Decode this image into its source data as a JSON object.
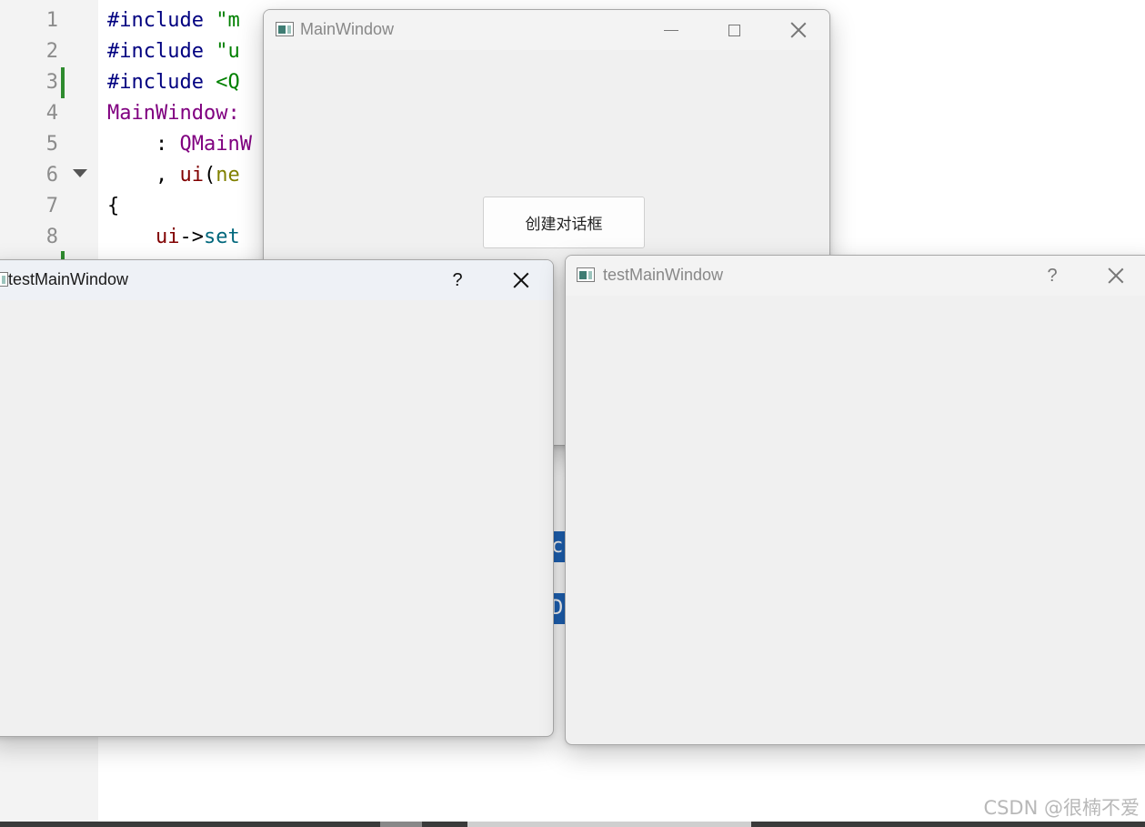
{
  "editor": {
    "line_numbers": [
      "1",
      "2",
      "3",
      "4",
      "5",
      "6",
      "7",
      "8"
    ],
    "lines": [
      [
        {
          "t": "#include ",
          "c": "dir"
        },
        {
          "t": "\"m",
          "c": "str"
        }
      ],
      [
        {
          "t": "#include ",
          "c": "dir"
        },
        {
          "t": "\"u",
          "c": "str"
        }
      ],
      [
        {
          "t": "#include ",
          "c": "dir"
        },
        {
          "t": "<Q",
          "c": "str"
        }
      ],
      [
        {
          "t": "MainWindow:",
          "c": "ty"
        }
      ],
      [
        {
          "t": "    : ",
          "c": "pl"
        },
        {
          "t": "QMainW",
          "c": "ty"
        }
      ],
      [
        {
          "t": "    , ",
          "c": "pl"
        },
        {
          "t": "ui",
          "c": "var"
        },
        {
          "t": "(",
          "c": "pl"
        },
        {
          "t": "ne",
          "c": "ar"
        }
      ],
      [
        {
          "t": "{",
          "c": "pl"
        }
      ],
      [
        {
          "t": "    ",
          "c": "pl"
        },
        {
          "t": "ui",
          "c": "var"
        },
        {
          "t": "->",
          "c": "pl"
        },
        {
          "t": "set",
          "c": "fn"
        }
      ]
    ],
    "selection_chips": [
      "c",
      "D"
    ]
  },
  "main_window": {
    "title": "MainWindow",
    "button_label": "创建对话框"
  },
  "dialog_left": {
    "title": "testMainWindow",
    "help_label": "?"
  },
  "dialog_right": {
    "title": "testMainWindow",
    "help_label": "?"
  },
  "watermark": "CSDN @很楠不爱",
  "colors": {
    "directive": "#000080",
    "string": "#008000",
    "type": "#800080",
    "function": "#00677c",
    "window_bg": "#f0f0f0",
    "selection": "#1f64b8"
  }
}
